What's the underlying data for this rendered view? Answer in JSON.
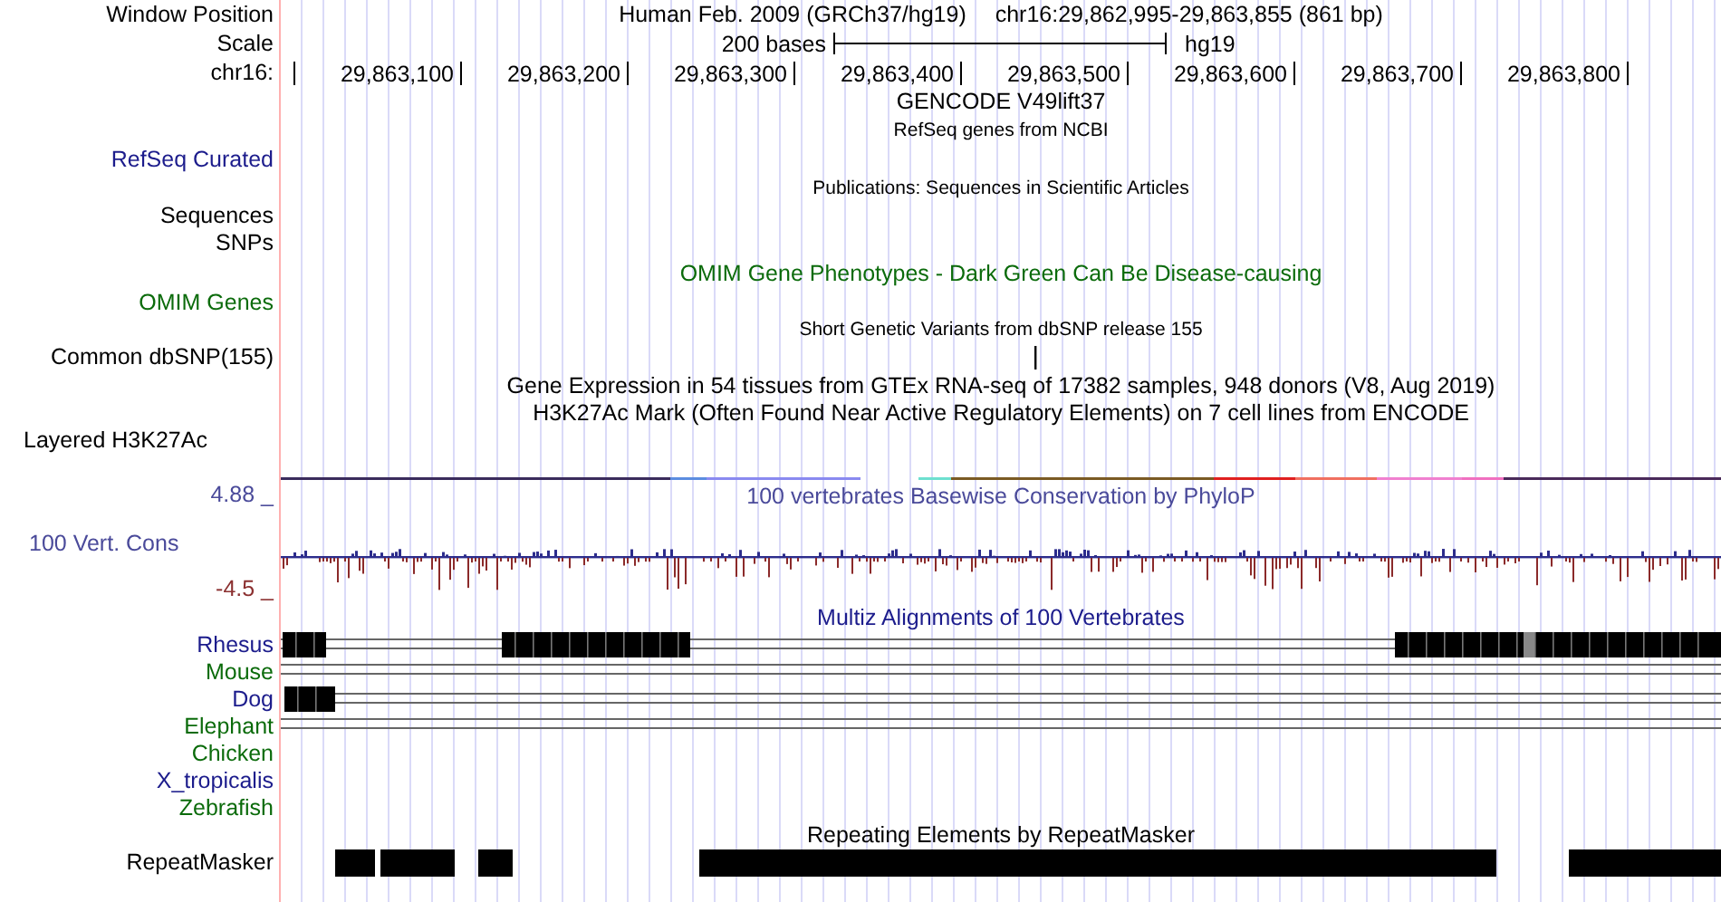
{
  "header": {
    "label": "Window Position",
    "title": "Human Feb. 2009 (GRCh37/hg19)",
    "position": "chr16:29,862,995-29,863,855 (861 bp)"
  },
  "scale": {
    "label": "Scale",
    "bases": "200 bases",
    "assembly": "hg19"
  },
  "ruler": {
    "label": "chr16:",
    "ticks": [
      "29,863,100",
      "29,863,200",
      "29,863,300",
      "29,863,400",
      "29,863,500",
      "29,863,600",
      "29,863,700",
      "29,863,800"
    ]
  },
  "rows": [
    {
      "kind": "title",
      "text": "GENCODE V49lift37",
      "color": "#000000"
    },
    {
      "kind": "subtitle",
      "text": "RefSeq genes from NCBI"
    },
    {
      "kind": "label",
      "label": "RefSeq Curated",
      "color": "#1c1c8c"
    },
    {
      "kind": "subtitle",
      "text": "Publications: Sequences in Scientific Articles"
    },
    {
      "kind": "label",
      "label": "Sequences",
      "color": "#000000"
    },
    {
      "kind": "label",
      "label": "SNPs",
      "color": "#000000"
    },
    {
      "kind": "title",
      "text": "OMIM Gene Phenotypes - Dark Green Can Be Disease-causing",
      "color": "#0b6b0b"
    },
    {
      "kind": "label",
      "label": "OMIM Genes",
      "color": "#0b6b0b"
    },
    {
      "kind": "subtitle",
      "text": "Short Genetic Variants from dbSNP release 155"
    },
    {
      "kind": "variant",
      "label": "Common dbSNP(155)",
      "color": "#000000"
    },
    {
      "kind": "title",
      "text": "Gene Expression in 54 tissues from GTEx RNA-seq of 17382 samples, 948 donors (V8, Aug 2019)",
      "color": "#000000"
    },
    {
      "kind": "title",
      "text": "H3K27Ac Mark (Often Found Near Active Regulatory Elements) on 7 cell lines from ENCODE",
      "color": "#000000"
    },
    {
      "kind": "layered",
      "label": "Layered H3K27Ac",
      "color": "#000000"
    }
  ],
  "conservation": {
    "max": "4.88 _",
    "label": "100 Vert. Cons",
    "min": "-4.5 _",
    "title": "100 vertebrates Basewise Conservation by PhyloP"
  },
  "multiz": {
    "title": "Multiz Alignments of 100 Vertebrates",
    "species": [
      {
        "name": "Rhesus",
        "color": "#1c1c8c",
        "kind": "blocks"
      },
      {
        "name": "Mouse",
        "color": "#0b6b0b",
        "kind": "lines"
      },
      {
        "name": "Dog",
        "color": "#1c1c8c",
        "kind": "blocks"
      },
      {
        "name": "Elephant",
        "color": "#0b6b0b",
        "kind": "lines"
      },
      {
        "name": "Chicken",
        "color": "#0b6b0b",
        "kind": "none"
      },
      {
        "name": "X_tropicalis",
        "color": "#1c1c8c",
        "kind": "none"
      },
      {
        "name": "Zebrafish",
        "color": "#0b6b0b",
        "kind": "none"
      }
    ]
  },
  "repeats": {
    "title": "Repeating Elements by RepeatMasker",
    "label": "RepeatMasker"
  }
}
